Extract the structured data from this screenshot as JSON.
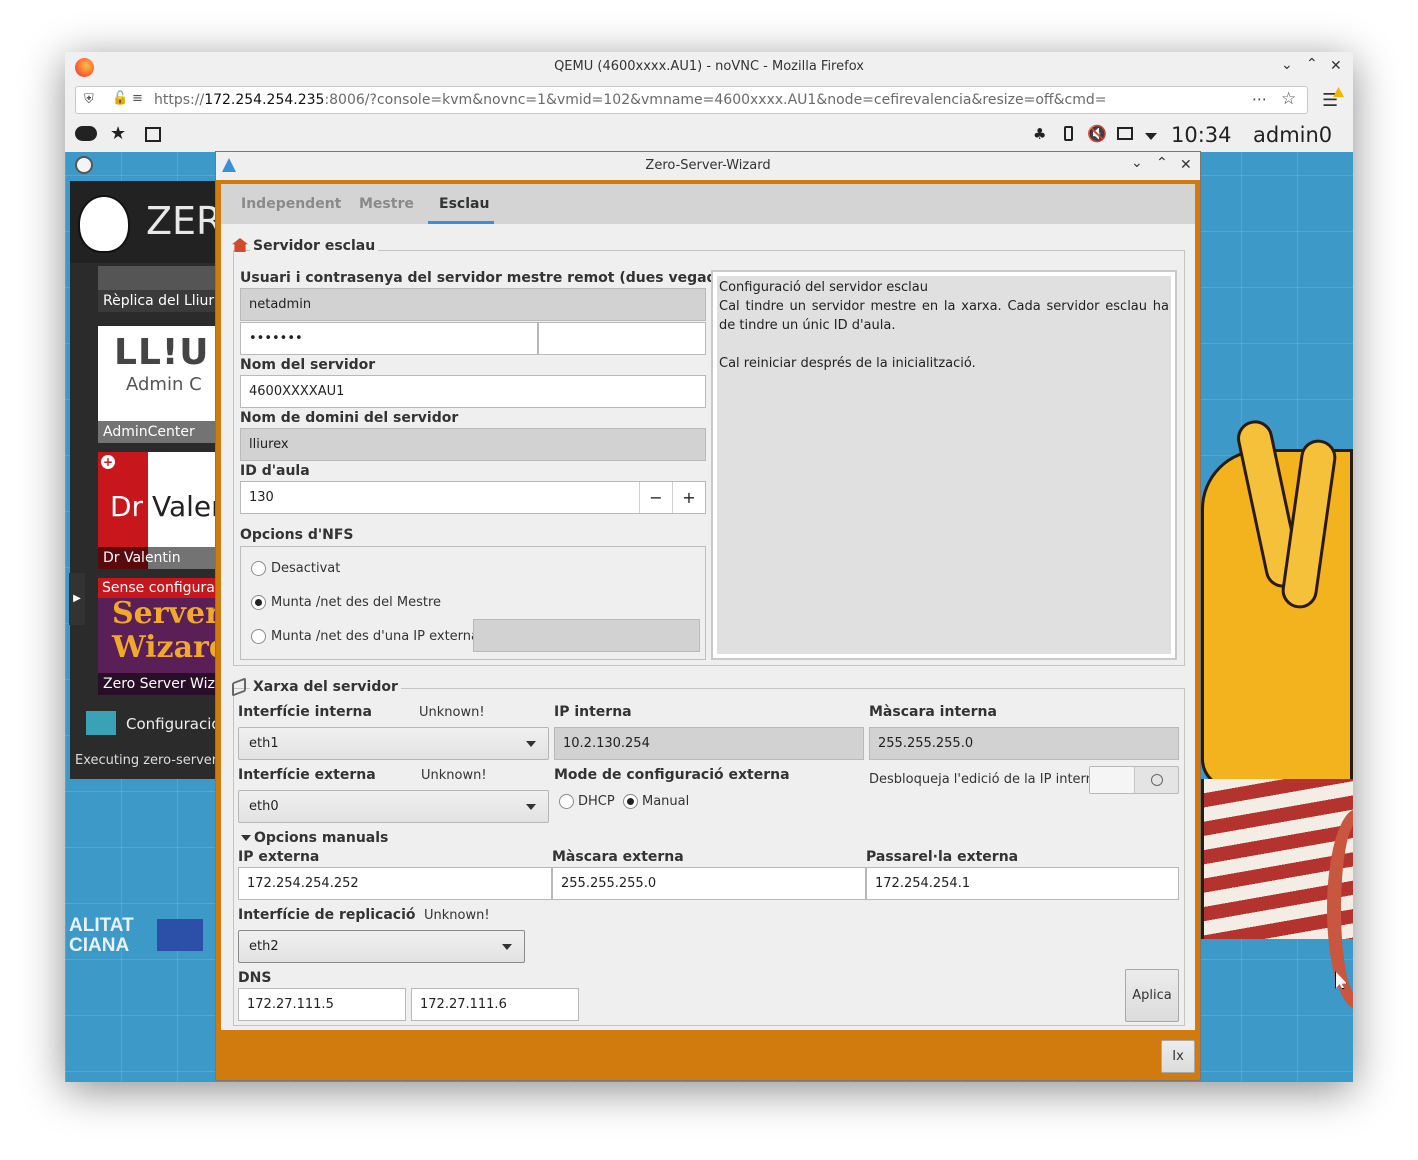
{
  "browser": {
    "title": "QEMU (4600xxxx.AU1) - noVNC - Mozilla Firefox",
    "url_prefix": "https://",
    "url_host": "172.254.254.235",
    "url_rest": ":8006/?console=kvm&novnc=1&vmid=102&vmname=4600xxxx.AU1&node=cefirevalencia&resize=off&cmd="
  },
  "guest_panel": {
    "clock": "10:34",
    "user": "admin0"
  },
  "launcher": {
    "logo_text": "ZER",
    "items": [
      {
        "label": "Rèplica del Lliur"
      },
      {
        "label": "AdminCenter",
        "logo_text": "LL!U",
        "logo_sub": "Admin C"
      },
      {
        "label": "Dr Valentin",
        "logo_text": "Dr",
        "logo_text2": "Valer"
      },
      {
        "label": "Zero Server Wiz",
        "banner": "Sense configura",
        "art_line1": "Server",
        "art_line2": "Wizard"
      }
    ],
    "config_label": "Configuració",
    "status": "Executing zero-server-",
    "bg_text1": "ALITAT",
    "bg_text2": "CIANA"
  },
  "window": {
    "title": "Zero-Server-Wizard",
    "tabs": [
      {
        "label": "Independent",
        "active": false
      },
      {
        "label": "Mestre",
        "active": false
      },
      {
        "label": "Esclau",
        "active": true
      }
    ]
  },
  "slave": {
    "group_title": "Servidor esclau",
    "credentials_label": "Usuari i contrasenya del servidor mestre remot (dues vegades)",
    "username": "netadmin",
    "password_mask": "•••••••",
    "password_confirm": "",
    "server_name_label": "Nom del servidor",
    "server_name": "4600XXXXAU1",
    "domain_label": "Nom de domini del servidor",
    "domain": "lliurex",
    "classroom_label": "ID d'aula",
    "classroom_id": "130",
    "minus": "−",
    "plus": "+",
    "nfs_label": "Opcions d'NFS",
    "nfs_options": [
      {
        "label": "Desactivat",
        "selected": false
      },
      {
        "label": "Munta /net des del Mestre",
        "selected": true
      },
      {
        "label": "Munta /net des d'una IP externa",
        "selected": false
      }
    ],
    "nfs_external_ip": "",
    "info_title": "Configuració del servidor esclau",
    "info_body": "Cal tindre un servidor mestre en la xarxa. Cada servidor esclau ha de tindre un únic ID d'aula.",
    "info_note": "Cal reiniciar després de la inicialització."
  },
  "network": {
    "group_title": "Xarxa del servidor",
    "internal_iface_label": "Interfície interna",
    "internal_iface_status": "Unknown!",
    "internal_iface": "eth1",
    "internal_ip_label": "IP interna",
    "internal_ip": "10.2.130.254",
    "internal_mask_label": "Màscara interna",
    "internal_mask": "255.255.255.0",
    "external_iface_label": "Interfície externa",
    "external_iface_status": "Unknown!",
    "external_iface": "eth0",
    "external_mode_label": "Mode de configuració externa",
    "mode_dhcp": "DHCP",
    "mode_manual": "Manual",
    "mode_selected": "Manual",
    "unlock_label": "Desbloqueja l'edició de la IP interna",
    "manual_section": "Opcions manuals",
    "external_ip_label": "IP externa",
    "external_ip": "172.254.254.252",
    "external_mask_label": "Màscara externa",
    "external_mask": "255.255.255.0",
    "gateway_label": "Passarel·la externa",
    "gateway": "172.254.254.1",
    "replication_iface_label": "Interfície de replicació",
    "replication_iface_status": "Unknown!",
    "replication_iface": "eth2",
    "dns_label": "DNS",
    "dns1": "172.27.111.5",
    "dns2": "172.27.111.6",
    "apply_label": "Aplica"
  },
  "footer": {
    "exit_label": "Ix"
  },
  "colors": {
    "accent_orange": "#d17b0e",
    "tab_underline": "#3b8fd6",
    "guest_background": "#3d99c8"
  }
}
